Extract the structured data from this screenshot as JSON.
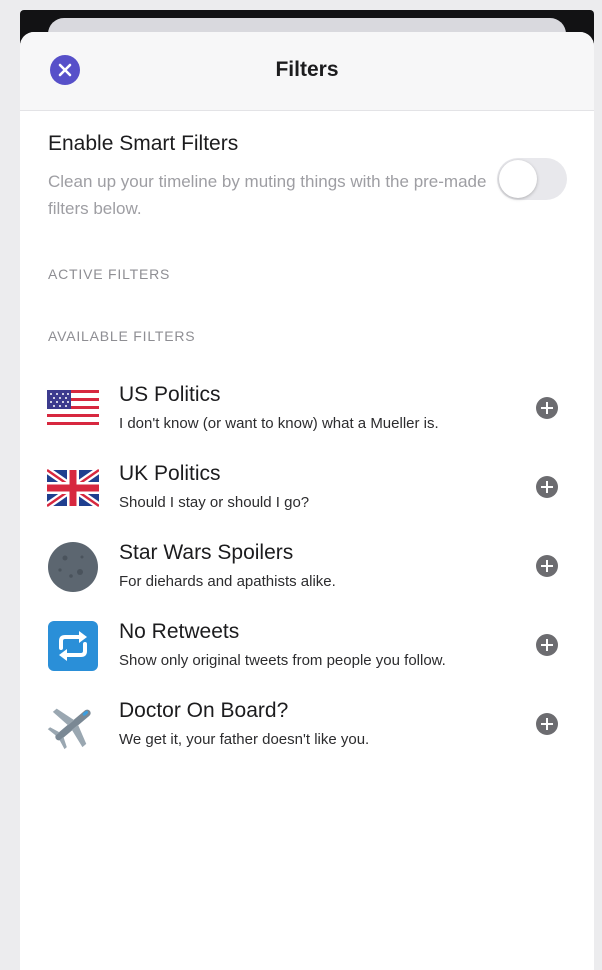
{
  "header": {
    "title": "Filters"
  },
  "smart_filters": {
    "title": "Enable Smart Filters",
    "description": "Clean up your timeline by muting things with the pre-made filters below.",
    "enabled": false
  },
  "sections": {
    "active": "ACTIVE FILTERS",
    "available": "AVAILABLE FILTERS"
  },
  "available_filters": [
    {
      "icon": "us-flag-icon",
      "title": "US Politics",
      "subtitle": "I don't know (or want to know) what a Mueller is."
    },
    {
      "icon": "uk-flag-icon",
      "title": "UK Politics",
      "subtitle": "Should I stay or should I go?"
    },
    {
      "icon": "death-star-icon",
      "title": "Star Wars Spoilers",
      "subtitle": "For diehards and apathists alike."
    },
    {
      "icon": "retweet-icon",
      "title": "No Retweets",
      "subtitle": "Show only original tweets from people you follow."
    },
    {
      "icon": "airplane-icon",
      "title": "Doctor On Board?",
      "subtitle": "We get it, your father doesn't like you."
    }
  ],
  "colors": {
    "accent": "#5750c9",
    "retweet_blue": "#2a8fd8",
    "add_button": "#6c6c70",
    "secondary_text": "#9e9ea3"
  }
}
